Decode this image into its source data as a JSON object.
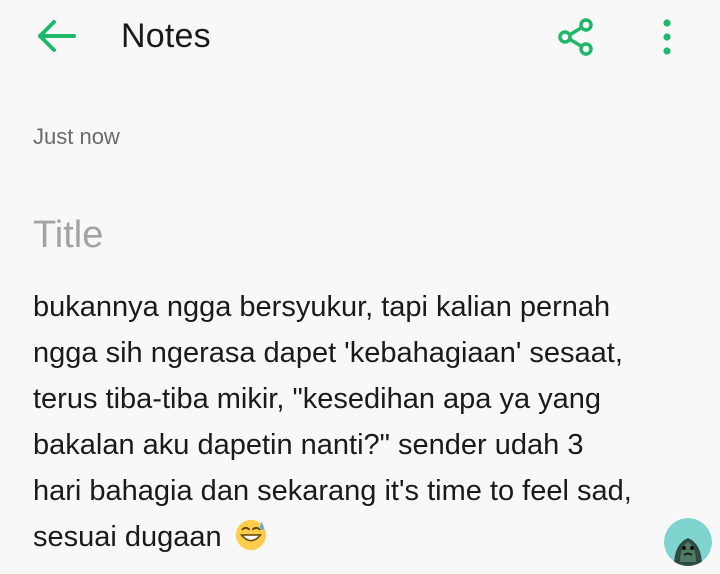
{
  "header": {
    "back_icon": "arrow-left-icon",
    "title": "Notes",
    "share_icon": "share-icon",
    "more_icon": "more-vertical-icon",
    "accent_color": "#1fb86a"
  },
  "note": {
    "timestamp": "Just now",
    "title_placeholder": "Title",
    "body_lines": [
      "bukannya ngga bersyukur, tapi kalian pernah",
      "ngga sih ngerasa dapet 'kebahagiaan' sesaat,",
      "terus tiba-tiba mikir, \"kesedihan apa ya yang",
      "bakalan aku dapetin nanti?\" sender udah 3",
      "hari bahagia dan sekarang it's time to feel sad,",
      "sesuai dugaan"
    ],
    "trailing_emoji": "grinning-sweat-emoji"
  },
  "floating": {
    "avatar_icon": "avatar-icon"
  }
}
